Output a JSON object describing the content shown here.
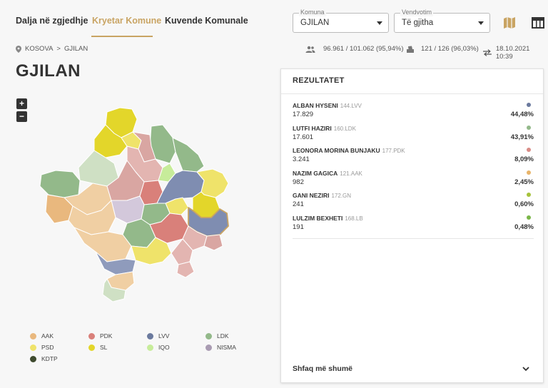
{
  "nav": {
    "tabs": [
      {
        "label": "Dalja në zgjedhje"
      },
      {
        "label": "Kryetar Komune"
      },
      {
        "label": "Kuvende Komunale"
      }
    ]
  },
  "filters": {
    "komuna": {
      "label": "Komuna",
      "value": "GJILAN"
    },
    "vendvotim": {
      "label": "Vendvotim",
      "value": "Të gjitha"
    }
  },
  "breadcrumb": {
    "root": "KOSOVA",
    "separator": ">",
    "current": "GJILAN"
  },
  "stats": {
    "turnout": "96.961 / 101.062 (95,94%)",
    "stations": "121 / 126 (96,03%)",
    "updated": "18.10.2021 10:39"
  },
  "page_title": "GJILAN",
  "zoom": {
    "in": "+",
    "out": "−"
  },
  "results": {
    "header": "REZULTATET",
    "rows": [
      {
        "name": "ALBAN HYSENI",
        "code": "144.LVV",
        "votes": "17.829",
        "pct": "44,48%",
        "color": "#6b7a9e"
      },
      {
        "name": "LUTFI HAZIRI",
        "code": "160.LDK",
        "votes": "17.601",
        "pct": "43,91%",
        "color": "#93b98a"
      },
      {
        "name": "LEONORA MORINA BUNJAKU",
        "code": "177.PDK",
        "votes": "3.241",
        "pct": "8,09%",
        "color": "#d98c86"
      },
      {
        "name": "NAZIM GAGICA",
        "code": "121.AAK",
        "votes": "982",
        "pct": "2,45%",
        "color": "#e8b46a"
      },
      {
        "name": "GANI NEZIRI",
        "code": "172.GN",
        "votes": "241",
        "pct": "0,60%",
        "color": "#a6c23c"
      },
      {
        "name": "LULZIM BEXHETI",
        "code": "168.LB",
        "votes": "191",
        "pct": "0,48%",
        "color": "#7ab648"
      }
    ],
    "more_label": "Shfaq më shumë"
  },
  "legend": [
    {
      "label": "AAK",
      "color": "#e9b87e"
    },
    {
      "label": "PDK",
      "color": "#d9807a"
    },
    {
      "label": "LVV",
      "color": "#6b7a9e"
    },
    {
      "label": "LDK",
      "color": "#93b98a"
    },
    {
      "label": "PSD",
      "color": "#efe36a"
    },
    {
      "label": "SL",
      "color": "#e3d62a"
    },
    {
      "label": "IQO",
      "color": "#c7ec9a"
    },
    {
      "label": "NISMA",
      "color": "#a99bb2"
    },
    {
      "label": "KDTP",
      "color": "#3e4a2e"
    }
  ]
}
